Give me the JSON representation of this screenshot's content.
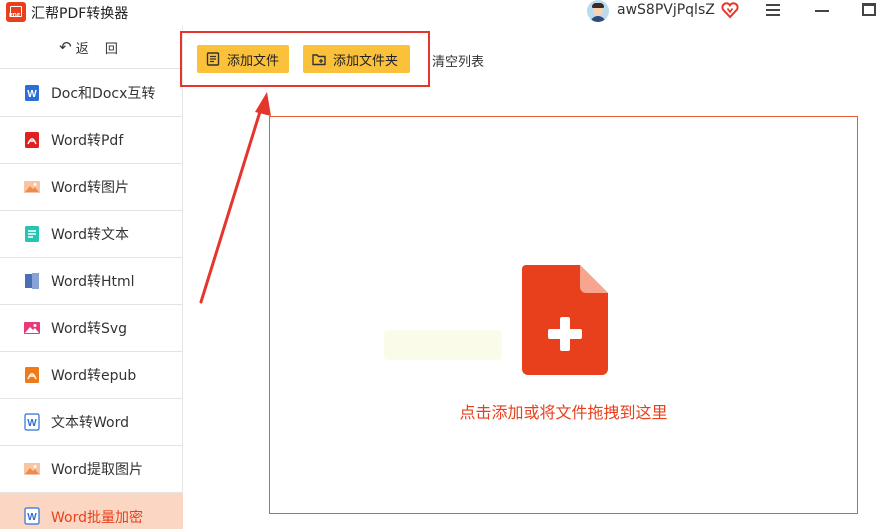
{
  "app": {
    "title": "汇帮PDF转换器",
    "logo_text": "PDF"
  },
  "header": {
    "username": "awS8PVjPqlsZ"
  },
  "sidebar": {
    "back_label": "返 回",
    "items": [
      {
        "label": "Doc和Docx互转",
        "icon": "word-doc-icon",
        "color": "#2b6fd6"
      },
      {
        "label": "Word转Pdf",
        "icon": "pdf-icon",
        "color": "#e02020"
      },
      {
        "label": "Word转图片",
        "icon": "image-icon",
        "color": "#f08a4b"
      },
      {
        "label": "Word转文本",
        "icon": "text-file-icon",
        "color": "#25c5b5"
      },
      {
        "label": "Word转Html",
        "icon": "html-icon",
        "color": "#4a6fb5"
      },
      {
        "label": "Word转Svg",
        "icon": "svg-image-icon",
        "color": "#e83a7a"
      },
      {
        "label": "Word转epub",
        "icon": "epub-icon",
        "color": "#f07a1a"
      },
      {
        "label": "文本转Word",
        "icon": "word-doc-icon",
        "color": "#2b6fd6"
      },
      {
        "label": "Word提取图片",
        "icon": "image-icon",
        "color": "#f08a4b"
      },
      {
        "label": "Word批量加密",
        "icon": "word-doc-icon",
        "color": "#2b6fd6",
        "active": true
      }
    ]
  },
  "toolbar": {
    "add_file_label": "添加文件",
    "add_folder_label": "添加文件夹",
    "clear_list_label": "清空列表"
  },
  "dropzone": {
    "hint_text": "点击添加或将文件拖拽到这里"
  },
  "colors": {
    "accent": "#e8401c",
    "button": "#fbc13b",
    "highlight_box": "#e5352d",
    "active_bg": "#fbd7c3"
  }
}
